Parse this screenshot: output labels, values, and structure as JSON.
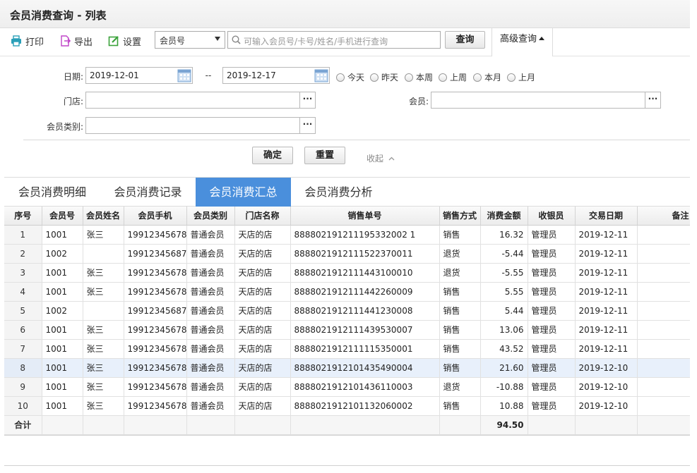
{
  "page": {
    "title": "会员消费查询 - 列表"
  },
  "toolbar": {
    "print_label": "打印",
    "export_label": "导出",
    "settings_label": "设置",
    "field_select_value": "会员号",
    "search_placeholder": "可输入会员号/卡号/姓名/手机进行查询",
    "query_label": "查询",
    "advanced_label": "高级查询"
  },
  "filters": {
    "date_label": "日期:",
    "date_from": "2019-12-01",
    "date_sep": "--",
    "date_to": "2019-12-17",
    "quick_ranges": [
      "今天",
      "昨天",
      "本周",
      "上周",
      "本月",
      "上月"
    ],
    "store_label": "门店:",
    "store_value": "",
    "member_label": "会员:",
    "member_value": "",
    "member_type_label": "会员类别:",
    "member_type_value": "",
    "confirm_label": "确定",
    "reset_label": "重置",
    "collapse_label": "收起"
  },
  "tabs": [
    {
      "label": "会员消费明细",
      "active": false
    },
    {
      "label": "会员消费记录",
      "active": false
    },
    {
      "label": "会员消费汇总",
      "active": true
    },
    {
      "label": "会员消费分析",
      "active": false
    }
  ],
  "table": {
    "columns": [
      "序号",
      "会员号",
      "会员姓名",
      "会员手机",
      "会员类别",
      "门店名称",
      "销售单号",
      "销售方式",
      "消费金额",
      "收银员",
      "交易日期",
      "备注"
    ],
    "rows": [
      [
        "1",
        "1001",
        "张三",
        "19912345678",
        "普通会员",
        "天店的店",
        "888802191211195332002 1",
        "销售",
        "16.32",
        "管理员",
        "2019-12-11",
        ""
      ],
      [
        "2",
        "1002",
        "",
        "19912345687",
        "普通会员",
        "天店的店",
        "8888021912111522370011",
        "退货",
        "-5.44",
        "管理员",
        "2019-12-11",
        ""
      ],
      [
        "3",
        "1001",
        "张三",
        "19912345678",
        "普通会员",
        "天店的店",
        "8888021912111443100010",
        "退货",
        "-5.55",
        "管理员",
        "2019-12-11",
        ""
      ],
      [
        "4",
        "1001",
        "张三",
        "19912345678",
        "普通会员",
        "天店的店",
        "8888021912111442260009",
        "销售",
        "5.55",
        "管理员",
        "2019-12-11",
        ""
      ],
      [
        "5",
        "1002",
        "",
        "19912345687",
        "普通会员",
        "天店的店",
        "8888021912111441230008",
        "销售",
        "5.44",
        "管理员",
        "2019-12-11",
        ""
      ],
      [
        "6",
        "1001",
        "张三",
        "19912345678",
        "普通会员",
        "天店的店",
        "8888021912111439530007",
        "销售",
        "13.06",
        "管理员",
        "2019-12-11",
        ""
      ],
      [
        "7",
        "1001",
        "张三",
        "19912345678",
        "普通会员",
        "天店的店",
        "8888021912111115350001",
        "销售",
        "43.52",
        "管理员",
        "2019-12-11",
        ""
      ],
      [
        "8",
        "1001",
        "张三",
        "19912345678",
        "普通会员",
        "天店的店",
        "8888021912101435490004",
        "销售",
        "21.60",
        "管理员",
        "2019-12-10",
        ""
      ],
      [
        "9",
        "1001",
        "张三",
        "19912345678",
        "普通会员",
        "天店的店",
        "8888021912101436110003",
        "退货",
        "-10.88",
        "管理员",
        "2019-12-10",
        ""
      ],
      [
        "10",
        "1001",
        "张三",
        "19912345678",
        "普通会员",
        "天店的店",
        "8888021912101132060002",
        "销售",
        "10.88",
        "管理员",
        "2019-12-10",
        ""
      ]
    ],
    "highlight_row": 8,
    "total_label": "合计",
    "total_amount": "94.50"
  },
  "colors": {
    "accent": "#4a8fdc",
    "row_highlight": "#e8f0fb"
  }
}
